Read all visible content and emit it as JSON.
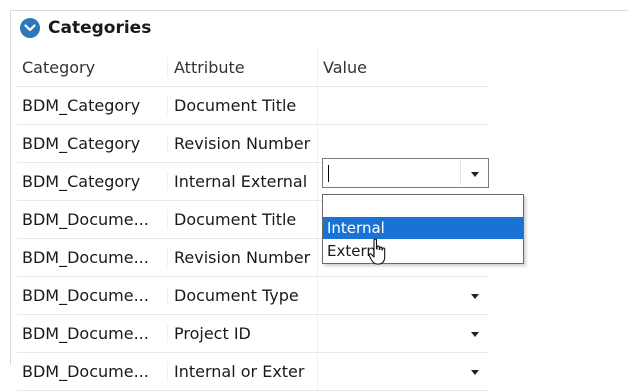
{
  "section": {
    "title": "Categories",
    "icon": "chevron-down-circle-icon"
  },
  "columns": [
    "Category",
    "Attribute",
    "Value"
  ],
  "rows": [
    {
      "category": "BDM_Category",
      "attribute": "Document Title",
      "value": "",
      "dropdown": false
    },
    {
      "category": "BDM_Category",
      "attribute": "Revision Number",
      "value": "",
      "dropdown": false
    },
    {
      "category": "BDM_Category",
      "attribute": "Internal  External",
      "value": "",
      "dropdown": true,
      "editing": true
    },
    {
      "category": "BDM_Docume...",
      "attribute": "Document Title",
      "value": "",
      "dropdown": false
    },
    {
      "category": "BDM_Docume...",
      "attribute": "Revision Number",
      "value": "",
      "dropdown": false
    },
    {
      "category": "BDM_Docume...",
      "attribute": "Document Type",
      "value": "",
      "dropdown": true
    },
    {
      "category": "BDM_Docume...",
      "attribute": "Project ID",
      "value": "",
      "dropdown": true
    },
    {
      "category": "BDM_Docume...",
      "attribute": "Internal or Exter",
      "value": "",
      "dropdown": true
    }
  ],
  "dropdown_options": [
    "",
    "Internal",
    "Extern"
  ],
  "dropdown_selected": "Internal",
  "colors": {
    "accent": "#1a73d4",
    "icon": "#2f78b7"
  }
}
